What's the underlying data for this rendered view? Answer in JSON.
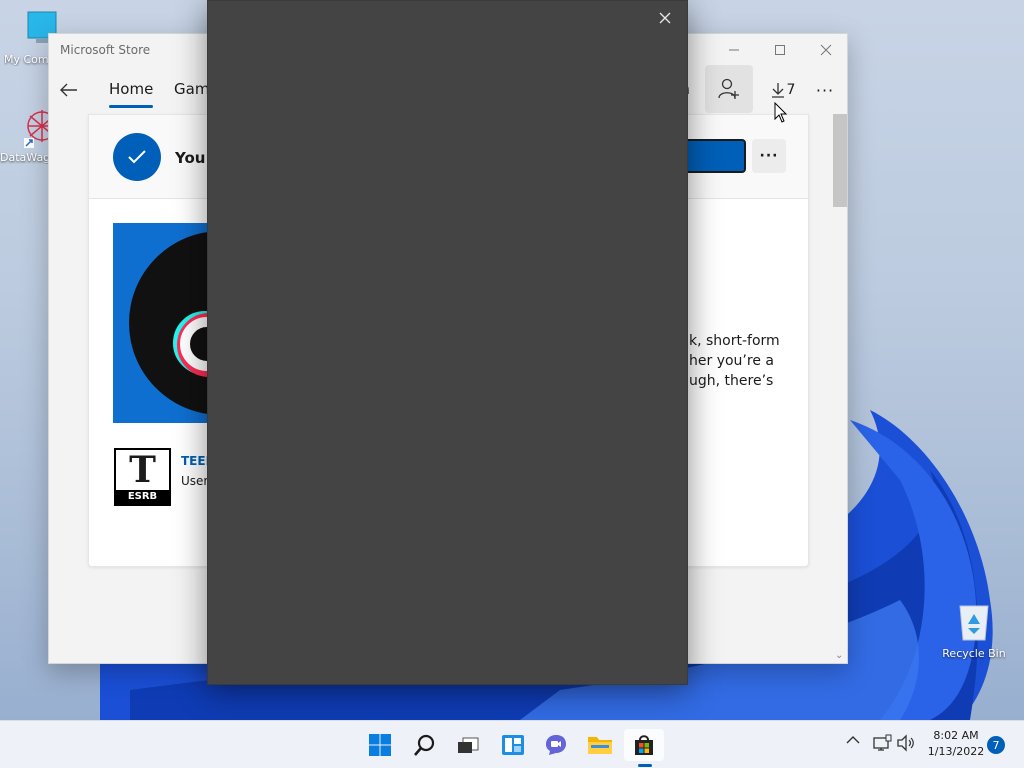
{
  "desktop": {
    "icons": [
      {
        "label": "My Computer",
        "icon": "monitor-icon"
      },
      {
        "label": "DataWagon",
        "icon": "datawagon-icon"
      },
      {
        "label": "Recycle Bin",
        "icon": "recycle-bin-icon"
      }
    ]
  },
  "store_window": {
    "title": "Microsoft Store",
    "nav": {
      "tabs": [
        {
          "label": "Home",
          "active": true
        },
        {
          "label": "Gami",
          "active": false
        }
      ],
      "partial_right_text": "a",
      "downloads_count": "7",
      "more_label": "···"
    },
    "card": {
      "owned_text": "You o",
      "more_label": "···",
      "description_lines": [
        "k, short-form",
        "her you’re a",
        "ugh, there’s"
      ],
      "rating": {
        "label": "TEEN",
        "sub": "User",
        "badge_letter": "T",
        "badge_brand": "ESRB"
      }
    }
  },
  "taskbar": {
    "clock_time": "8:02 AM",
    "clock_date": "1/13/2022",
    "notification_count": "7",
    "apps": [
      "start-icon",
      "search-icon",
      "task-view-icon",
      "widgets-icon",
      "chat-icon",
      "file-explorer-icon",
      "store-icon"
    ]
  },
  "colors": {
    "accent": "#005fb8",
    "overlay": "#444444",
    "wallpaper_blue": "#1450d8"
  }
}
